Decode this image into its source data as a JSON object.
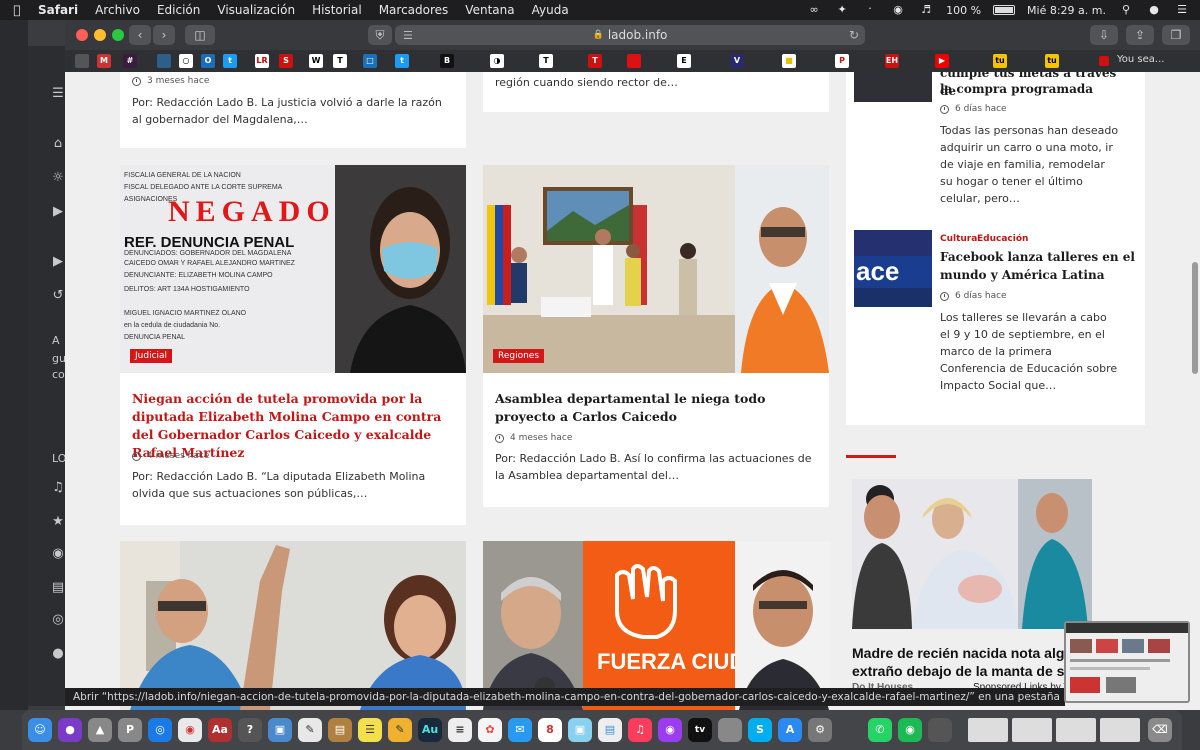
{
  "menubar": {
    "app": "Safari",
    "items": [
      "Archivo",
      "Edición",
      "Visualización",
      "Historial",
      "Marcadores",
      "Ventana",
      "Ayuda"
    ],
    "battery": "100 %",
    "clock": "Mié 8:29 a. m."
  },
  "browser": {
    "url": "ladob.info",
    "favorites_tail": "You sea..."
  },
  "background_sidebar": {
    "labels": [
      "A",
      "gu",
      "co",
      "LO"
    ]
  },
  "cards": [
    {
      "time": "3 meses hace",
      "excerpt": "Por: Redacción Lado B. La justicia volvió a darle la razón al gobernador del Magdalena,…"
    },
    {
      "excerpt": "región cuando siendo rector de…"
    },
    {
      "badge": "Judicial",
      "image_text": {
        "stamp": "NEGADO",
        "ref": "REF. DENUNCIA PENAL",
        "org": "FISCALIA GENERAL DE LA NACION"
      },
      "title": "Niegan acción de tutela promovida por la diputada Elizabeth Molina Campo en contra del Gobernador Carlos Caicedo y exalcalde Rafael Martínez",
      "time": "4 meses hace",
      "excerpt": "Por: Redacción Lado B.  “La diputada Elizabeth Molina olvida que sus actuaciones son públicas,…"
    },
    {
      "badge": "Regiones",
      "title": "Asamblea departamental le niega todo proyecto a Carlos Caicedo",
      "time": "4 meses hace",
      "excerpt": "Por: Redacción Lado B.   Así lo confirma las actuaciones de la Asamblea departamental del…"
    },
    {
      "image_text": "FUERZA CIUDADANA"
    }
  ],
  "sidebar": {
    "item1": {
      "title_partial": "cumple tus metas a través de",
      "title_line2": "la compra programada",
      "time": "6 días hace",
      "excerpt": "Todas las personas han deseado adquirir un carro o una moto, ir de viaje en familia, remodelar su hogar o tener el último celular, pero…"
    },
    "item2": {
      "categories": [
        "Cultura",
        "Educación"
      ],
      "title": "Facebook lanza talleres en el mundo y América Latina",
      "time": "6 días hace",
      "excerpt": "Los talleres se llevarán a cabo el 9 y 10 de septiembre, en el marco de la primera Conferencia de Educación sobre Impacto Social que…"
    },
    "ad": {
      "title": "Madre de recién nacida nota algo extraño debajo de la manta de su",
      "source": "Do It Houses",
      "sponsor": "Sponsored Links by Ta"
    }
  },
  "statusbar": {
    "text": "Abrir “https://ladob.info/niegan-accion-de-tutela-promovida-por-la-diputada-elizabeth-molina-campo-en-contra-del-gobernador-carlos-caicedo-y-exalcalde-rafael-martinez/” en una pestaña nueva detrás de l"
  },
  "colors": {
    "accent": "#d31616",
    "headline_red": "#c51515"
  }
}
